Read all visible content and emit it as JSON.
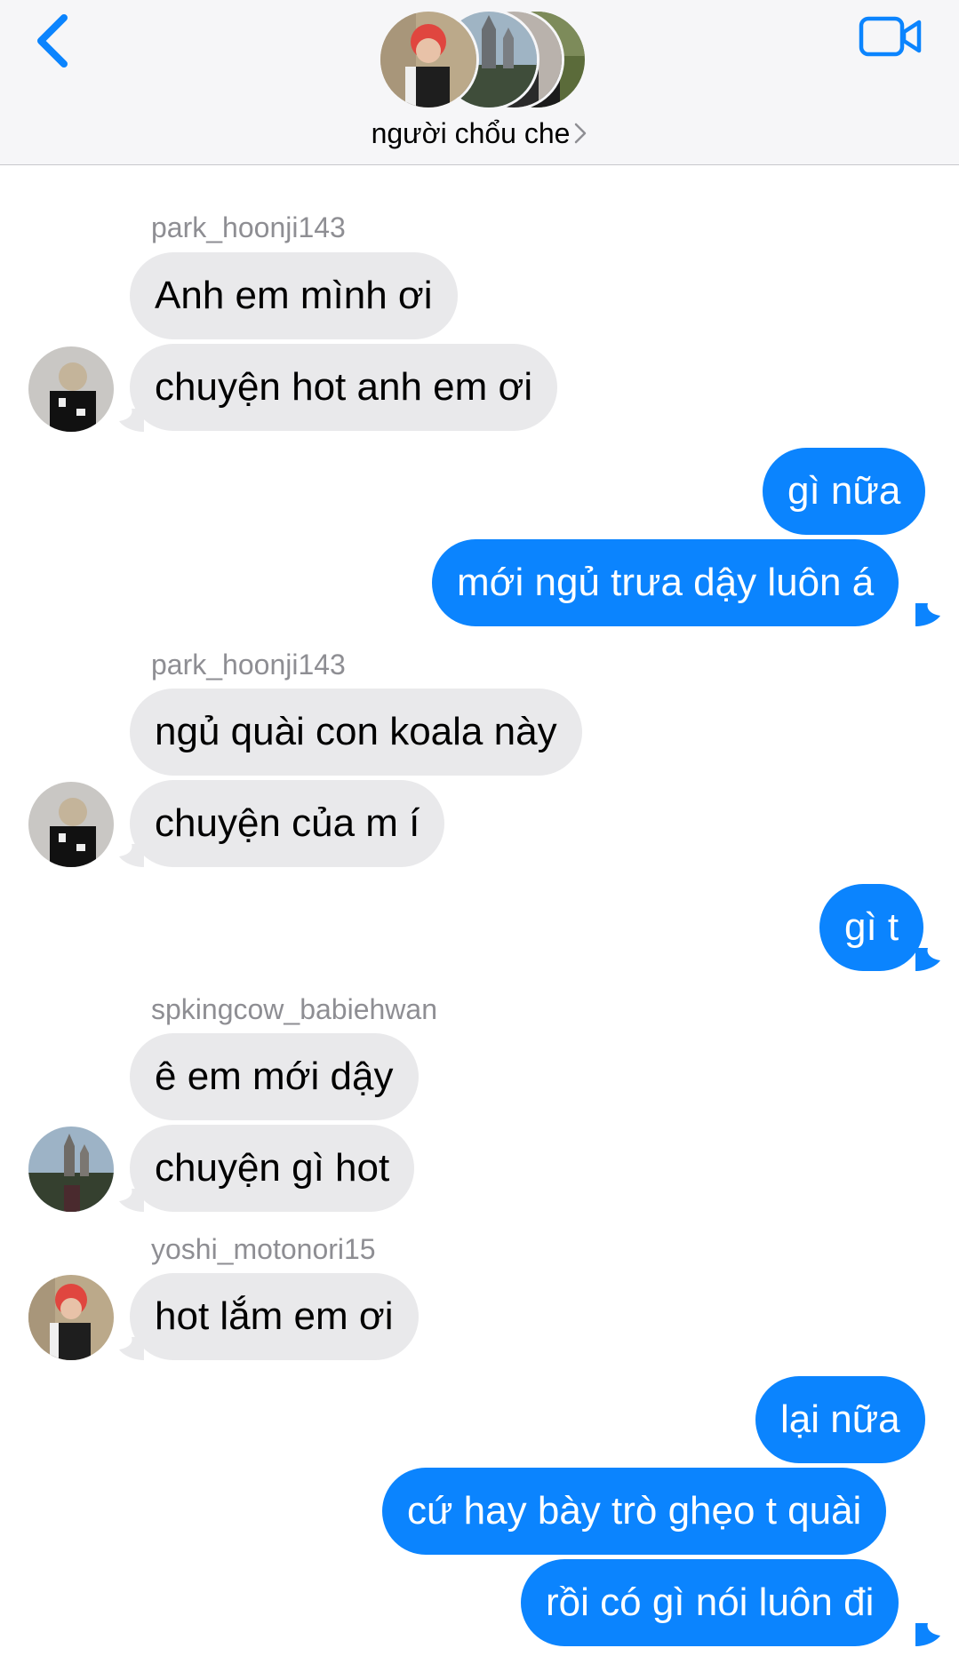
{
  "header": {
    "title": "người chổu che",
    "back_icon": "chevron-left-icon",
    "video_icon": "video-camera-icon",
    "accent_color": "#0b84fe"
  },
  "messages": [
    {
      "sender": "park_hoonji143",
      "side": "in",
      "text": "Anh em mình ơi"
    },
    {
      "side": "in",
      "text": "chuyện hot anh em ơi"
    },
    {
      "side": "out",
      "text": "gì nữa"
    },
    {
      "side": "out",
      "text": "mới ngủ trưa dậy luôn á"
    },
    {
      "sender": "park_hoonji143",
      "side": "in",
      "text": "ngủ quài con koala này"
    },
    {
      "side": "in",
      "text": "chuyện của m í"
    },
    {
      "side": "out",
      "text": "gì t"
    },
    {
      "sender": "spkingcow_babiehwan",
      "side": "in",
      "text": "ê em mới dậy"
    },
    {
      "side": "in",
      "text": "chuyện gì hot"
    },
    {
      "sender": "yoshi_motonori15",
      "side": "in",
      "text": "hot lắm em ơi"
    },
    {
      "side": "out",
      "text": "lại nữa"
    },
    {
      "side": "out",
      "text": "cứ hay bày trò ghẹo t quài"
    },
    {
      "side": "out",
      "text": "rồi có gì nói luôn đi"
    }
  ],
  "colors": {
    "incoming_bubble": "#e9e9eb",
    "outgoing_bubble": "#0b84fe",
    "sender_name": "#8e8e93"
  }
}
